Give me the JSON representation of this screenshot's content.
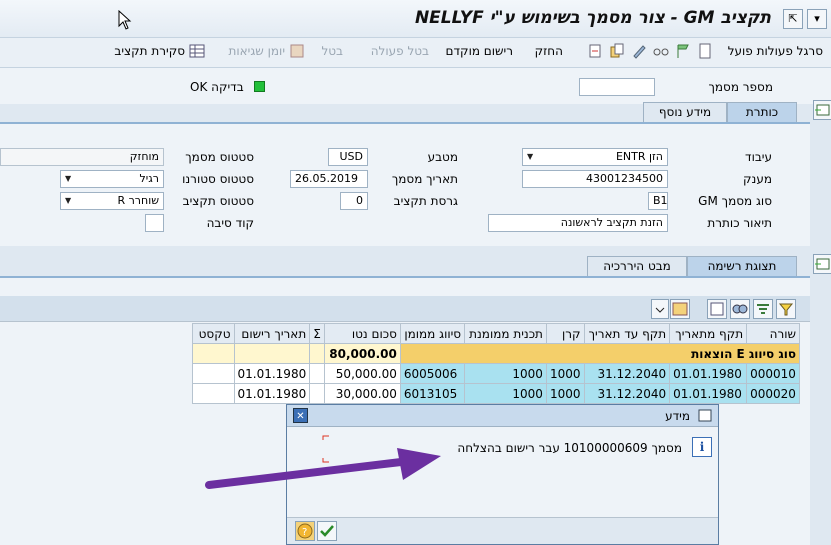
{
  "window": {
    "title": "תקציב GM - צור מסמך בשימוש ע\"י NELLYF"
  },
  "toolbar": {
    "items": [
      {
        "label": "סרגל פעולות פועל",
        "disabled": false
      },
      {
        "label": "החזק",
        "disabled": false
      },
      {
        "label": "רישום מוקדם",
        "disabled": false
      },
      {
        "label": "בטל פעולה",
        "disabled": true
      },
      {
        "label": "בטל",
        "disabled": true
      },
      {
        "label": "יומן שגיאות",
        "disabled": true
      },
      {
        "label": "סקירת תקציב",
        "disabled": false
      }
    ]
  },
  "header": {
    "doc_number_label": "מספר מסמך",
    "doc_number_value": "",
    "check_label": "בדיקה OK",
    "check_color": "#22c03a"
  },
  "tabs_top": [
    {
      "label": "כותרת",
      "active": true
    },
    {
      "label": "מידע נוסף",
      "active": false
    }
  ],
  "form": {
    "processing_label": "עיבוד",
    "processing_value": "ENTR הזן",
    "recipient_label": "מענק",
    "recipient_value": "43001234500",
    "doc_type_label": "סוג מסמך GM",
    "doc_type_value": "B1",
    "header_desc_label": "תיאור כותרת",
    "header_desc_value": "הזנת תקציב לראשונה",
    "currency_label": "מטבע",
    "currency_value": "USD",
    "doc_date_label": "תאריך מסמך",
    "doc_date_value": "26.05.2019",
    "budget_version_label": "גרסת תקציב",
    "budget_version_value": "0",
    "doc_status_label": "סטטוס מסמך",
    "doc_status_value": "מוחזק",
    "reversal_status_label": "סטטוס סטורנו",
    "reversal_status_value": "רגיל",
    "budget_status_label": "סטטוס תקציב",
    "budget_status_value": "R שוחרר",
    "reason_code_label": "קוד סיבה",
    "reason_code_value": ""
  },
  "tabs_bottom": [
    {
      "label": "תצוגת רשימה",
      "active": true
    },
    {
      "label": "מבט היררכיה",
      "active": false
    }
  ],
  "table": {
    "columns": [
      "שורה",
      "תקף מתאריך",
      "תקף עד תאריך",
      "קרן",
      "תכנית ממומנת",
      "סיווג ממומן",
      "סכום נטו",
      "Σ",
      "תאריך רישום",
      "טקסט"
    ],
    "group_row": {
      "label": "סוג סיווג E הוצאות",
      "total": "80,000.00"
    },
    "rows": [
      {
        "line": "000010",
        "valid_from": "01.01.1980",
        "valid_to": "31.12.2040",
        "fund": "1000",
        "program": "1000",
        "classification": "6005006",
        "amount": "50,000.00",
        "posting_date": "01.01.1980",
        "text": ""
      },
      {
        "line": "000020",
        "valid_from": "01.01.1980",
        "valid_to": "31.12.2040",
        "fund": "1000",
        "program": "1000",
        "classification": "6013105",
        "amount": "30,000.00",
        "posting_date": "01.01.1980",
        "text": ""
      }
    ]
  },
  "dialog": {
    "title": "מידע",
    "message": "מסמך 10100000609 עבר רישום בהצלחה",
    "close_label": "✕"
  }
}
